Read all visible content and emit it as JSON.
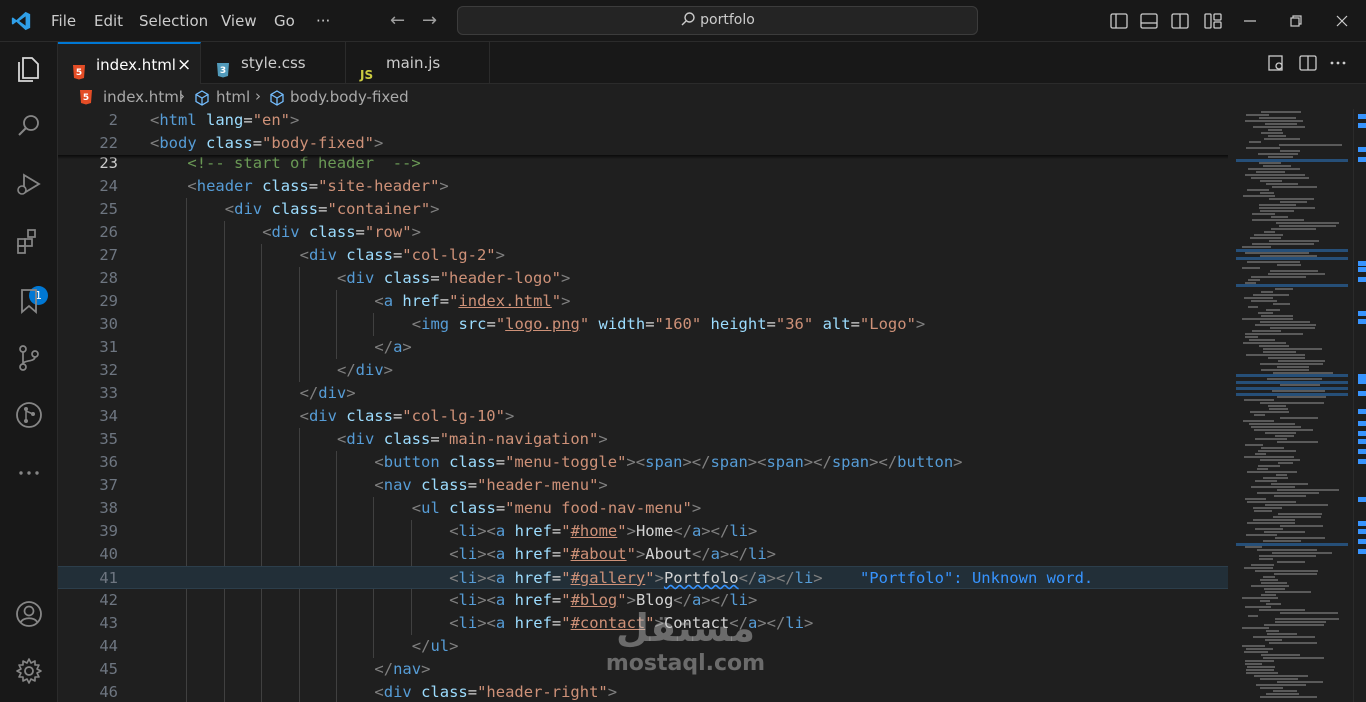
{
  "titlebar": {
    "menu": [
      "File",
      "Edit",
      "Selection",
      "View",
      "Go",
      "···"
    ],
    "search_text": "portfolo",
    "icons": [
      "vscode-logo-icon",
      "back-arrow-icon",
      "forward-arrow-icon",
      "search-icon",
      "toggle-primary-sidebar-icon",
      "toggle-panel-icon",
      "toggle-secondary-sidebar-icon",
      "customize-layout-icon",
      "minimize-icon",
      "restore-icon",
      "close-icon"
    ]
  },
  "activity_bar": {
    "items": [
      "explorer-icon",
      "search-icon",
      "run-debug-icon",
      "extensions-icon",
      "bookmarks-icon",
      "source-control-icon",
      "git-graph-icon",
      "more-icon"
    ],
    "extensions_badge": "1",
    "bottom": [
      "accounts-icon",
      "manage-gear-icon"
    ]
  },
  "tabs": [
    {
      "label": "index.html",
      "icon": "5",
      "icon_color": "#e44d26",
      "active": true,
      "close": "×"
    },
    {
      "label": "style.css",
      "icon": "3",
      "icon_color": "#519aba",
      "active": false
    },
    {
      "label": "main.js",
      "icon": "JS",
      "icon_color": "#cbcb41",
      "active": false
    }
  ],
  "breadcrumb": {
    "file": "index.html",
    "items": [
      "html",
      "body.body-fixed"
    ],
    "sep": "›"
  },
  "editor": {
    "sticky_lines": [
      {
        "n": "2",
        "tokens": [
          [
            "tg",
            "<"
          ],
          [
            "tn",
            "html"
          ],
          [
            "tx",
            " "
          ],
          [
            "an",
            "lang"
          ],
          [
            "tx",
            "="
          ],
          [
            "av",
            "\"en\""
          ],
          [
            "tg",
            ">"
          ]
        ]
      },
      {
        "n": "22",
        "tokens": [
          [
            "tg",
            "<"
          ],
          [
            "tn",
            "body"
          ],
          [
            "tx",
            " "
          ],
          [
            "an",
            "class"
          ],
          [
            "tx",
            "="
          ],
          [
            "av",
            "\"body-fixed\""
          ],
          [
            "tg",
            ">"
          ]
        ]
      }
    ],
    "lines": [
      {
        "n": "23",
        "indent": 1,
        "tokens": [
          [
            "cm",
            "<!-- start of header  -->"
          ]
        ]
      },
      {
        "n": "24",
        "indent": 1,
        "tokens": [
          [
            "tg",
            "<"
          ],
          [
            "tn",
            "header"
          ],
          [
            "tx",
            " "
          ],
          [
            "an",
            "class"
          ],
          [
            "tx",
            "="
          ],
          [
            "av",
            "\"site-header\""
          ],
          [
            "tg",
            ">"
          ]
        ]
      },
      {
        "n": "25",
        "indent": 2,
        "tokens": [
          [
            "tg",
            "<"
          ],
          [
            "tn",
            "div"
          ],
          [
            "tx",
            " "
          ],
          [
            "an",
            "class"
          ],
          [
            "tx",
            "="
          ],
          [
            "av",
            "\"container\""
          ],
          [
            "tg",
            ">"
          ]
        ]
      },
      {
        "n": "26",
        "indent": 3,
        "tokens": [
          [
            "tg",
            "<"
          ],
          [
            "tn",
            "div"
          ],
          [
            "tx",
            " "
          ],
          [
            "an",
            "class"
          ],
          [
            "tx",
            "="
          ],
          [
            "av",
            "\"row\""
          ],
          [
            "tg",
            ">"
          ]
        ]
      },
      {
        "n": "27",
        "indent": 4,
        "tokens": [
          [
            "tg",
            "<"
          ],
          [
            "tn",
            "div"
          ],
          [
            "tx",
            " "
          ],
          [
            "an",
            "class"
          ],
          [
            "tx",
            "="
          ],
          [
            "av",
            "\"col-lg-2\""
          ],
          [
            "tg",
            ">"
          ]
        ]
      },
      {
        "n": "28",
        "indent": 5,
        "tokens": [
          [
            "tg",
            "<"
          ],
          [
            "tn",
            "div"
          ],
          [
            "tx",
            " "
          ],
          [
            "an",
            "class"
          ],
          [
            "tx",
            "="
          ],
          [
            "av",
            "\"header-logo\""
          ],
          [
            "tg",
            ">"
          ]
        ]
      },
      {
        "n": "29",
        "indent": 6,
        "tokens": [
          [
            "tg",
            "<"
          ],
          [
            "tn",
            "a"
          ],
          [
            "tx",
            " "
          ],
          [
            "an",
            "href"
          ],
          [
            "tx",
            "="
          ],
          [
            "av",
            "\""
          ],
          [
            "avu",
            "index.html"
          ],
          [
            "av",
            "\""
          ],
          [
            "tg",
            ">"
          ]
        ]
      },
      {
        "n": "30",
        "indent": 7,
        "tokens": [
          [
            "tg",
            "<"
          ],
          [
            "tn",
            "img"
          ],
          [
            "tx",
            " "
          ],
          [
            "an",
            "src"
          ],
          [
            "tx",
            "="
          ],
          [
            "av",
            "\""
          ],
          [
            "avu",
            "logo.png"
          ],
          [
            "av",
            "\""
          ],
          [
            "tx",
            " "
          ],
          [
            "an",
            "width"
          ],
          [
            "tx",
            "="
          ],
          [
            "av",
            "\"160\""
          ],
          [
            "tx",
            " "
          ],
          [
            "an",
            "height"
          ],
          [
            "tx",
            "="
          ],
          [
            "av",
            "\"36\""
          ],
          [
            "tx",
            " "
          ],
          [
            "an",
            "alt"
          ],
          [
            "tx",
            "="
          ],
          [
            "av",
            "\"Logo\""
          ],
          [
            "tg",
            ">"
          ]
        ]
      },
      {
        "n": "31",
        "indent": 6,
        "tokens": [
          [
            "tg",
            "</"
          ],
          [
            "tn",
            "a"
          ],
          [
            "tg",
            ">"
          ]
        ]
      },
      {
        "n": "32",
        "indent": 5,
        "tokens": [
          [
            "tg",
            "</"
          ],
          [
            "tn",
            "div"
          ],
          [
            "tg",
            ">"
          ]
        ]
      },
      {
        "n": "33",
        "indent": 4,
        "tokens": [
          [
            "tg",
            "</"
          ],
          [
            "tn",
            "div"
          ],
          [
            "tg",
            ">"
          ]
        ]
      },
      {
        "n": "34",
        "indent": 4,
        "tokens": [
          [
            "tg",
            "<"
          ],
          [
            "tn",
            "div"
          ],
          [
            "tx",
            " "
          ],
          [
            "an",
            "class"
          ],
          [
            "tx",
            "="
          ],
          [
            "av",
            "\"col-lg-10\""
          ],
          [
            "tg",
            ">"
          ]
        ]
      },
      {
        "n": "35",
        "indent": 5,
        "tokens": [
          [
            "tg",
            "<"
          ],
          [
            "tn",
            "div"
          ],
          [
            "tx",
            " "
          ],
          [
            "an",
            "class"
          ],
          [
            "tx",
            "="
          ],
          [
            "av",
            "\"main-navigation\""
          ],
          [
            "tg",
            ">"
          ]
        ]
      },
      {
        "n": "36",
        "indent": 6,
        "tokens": [
          [
            "tg",
            "<"
          ],
          [
            "tn",
            "button"
          ],
          [
            "tx",
            " "
          ],
          [
            "an",
            "class"
          ],
          [
            "tx",
            "="
          ],
          [
            "av",
            "\"menu-toggle\""
          ],
          [
            "tg",
            ">"
          ],
          [
            "tg",
            "<"
          ],
          [
            "tn",
            "span"
          ],
          [
            "tg",
            ">"
          ],
          [
            "tg",
            "</"
          ],
          [
            "tn",
            "span"
          ],
          [
            "tg",
            ">"
          ],
          [
            "tg",
            "<"
          ],
          [
            "tn",
            "span"
          ],
          [
            "tg",
            ">"
          ],
          [
            "tg",
            "</"
          ],
          [
            "tn",
            "span"
          ],
          [
            "tg",
            ">"
          ],
          [
            "tg",
            "</"
          ],
          [
            "tn",
            "button"
          ],
          [
            "tg",
            ">"
          ]
        ]
      },
      {
        "n": "37",
        "indent": 6,
        "tokens": [
          [
            "tg",
            "<"
          ],
          [
            "tn",
            "nav"
          ],
          [
            "tx",
            " "
          ],
          [
            "an",
            "class"
          ],
          [
            "tx",
            "="
          ],
          [
            "av",
            "\"header-menu\""
          ],
          [
            "tg",
            ">"
          ]
        ]
      },
      {
        "n": "38",
        "indent": 7,
        "tokens": [
          [
            "tg",
            "<"
          ],
          [
            "tn",
            "ul"
          ],
          [
            "tx",
            " "
          ],
          [
            "an",
            "class"
          ],
          [
            "tx",
            "="
          ],
          [
            "av",
            "\"menu food-nav-menu\""
          ],
          [
            "tg",
            ">"
          ]
        ]
      },
      {
        "n": "39",
        "indent": 8,
        "tokens": [
          [
            "tg",
            "<"
          ],
          [
            "tn",
            "li"
          ],
          [
            "tg",
            ">"
          ],
          [
            "tg",
            "<"
          ],
          [
            "tn",
            "a"
          ],
          [
            "tx",
            " "
          ],
          [
            "an",
            "href"
          ],
          [
            "tx",
            "="
          ],
          [
            "av",
            "\""
          ],
          [
            "avu",
            "#home"
          ],
          [
            "av",
            "\""
          ],
          [
            "tg",
            ">"
          ],
          [
            "tx",
            "Home"
          ],
          [
            "tg",
            "</"
          ],
          [
            "tn",
            "a"
          ],
          [
            "tg",
            ">"
          ],
          [
            "tg",
            "</"
          ],
          [
            "tn",
            "li"
          ],
          [
            "tg",
            ">"
          ]
        ]
      },
      {
        "n": "40",
        "indent": 8,
        "tokens": [
          [
            "tg",
            "<"
          ],
          [
            "tn",
            "li"
          ],
          [
            "tg",
            ">"
          ],
          [
            "tg",
            "<"
          ],
          [
            "tn",
            "a"
          ],
          [
            "tx",
            " "
          ],
          [
            "an",
            "href"
          ],
          [
            "tx",
            "="
          ],
          [
            "av",
            "\""
          ],
          [
            "avu",
            "#about"
          ],
          [
            "av",
            "\""
          ],
          [
            "tg",
            ">"
          ],
          [
            "tx",
            "About"
          ],
          [
            "tg",
            "</"
          ],
          [
            "tn",
            "a"
          ],
          [
            "tg",
            ">"
          ],
          [
            "tg",
            "</"
          ],
          [
            "tn",
            "li"
          ],
          [
            "tg",
            ">"
          ]
        ]
      },
      {
        "n": "41",
        "indent": 8,
        "current": true,
        "tokens": [
          [
            "tg",
            "<"
          ],
          [
            "tn",
            "li"
          ],
          [
            "tg",
            ">"
          ],
          [
            "tg",
            "<"
          ],
          [
            "tn",
            "a"
          ],
          [
            "tx",
            " "
          ],
          [
            "an",
            "href"
          ],
          [
            "tx",
            "="
          ],
          [
            "av",
            "\""
          ],
          [
            "avu",
            "#gallery"
          ],
          [
            "av",
            "\""
          ],
          [
            "tg",
            ">"
          ],
          [
            "sq",
            "Portfolo"
          ],
          [
            "tg",
            "</"
          ],
          [
            "tn",
            "a"
          ],
          [
            "tg",
            ">"
          ],
          [
            "tg",
            "</"
          ],
          [
            "tn",
            "li"
          ],
          [
            "tg",
            ">"
          ],
          [
            "tx",
            "    "
          ],
          [
            "diag",
            "\"Portfolo\": Unknown word."
          ]
        ]
      },
      {
        "n": "42",
        "indent": 8,
        "tokens": [
          [
            "tg",
            "<"
          ],
          [
            "tn",
            "li"
          ],
          [
            "tg",
            ">"
          ],
          [
            "tg",
            "<"
          ],
          [
            "tn",
            "a"
          ],
          [
            "tx",
            " "
          ],
          [
            "an",
            "href"
          ],
          [
            "tx",
            "="
          ],
          [
            "av",
            "\""
          ],
          [
            "avu",
            "#blog"
          ],
          [
            "av",
            "\""
          ],
          [
            "tg",
            ">"
          ],
          [
            "tx",
            "Blog"
          ],
          [
            "tg",
            "</"
          ],
          [
            "tn",
            "a"
          ],
          [
            "tg",
            ">"
          ],
          [
            "tg",
            "</"
          ],
          [
            "tn",
            "li"
          ],
          [
            "tg",
            ">"
          ]
        ]
      },
      {
        "n": "43",
        "indent": 8,
        "tokens": [
          [
            "tg",
            "<"
          ],
          [
            "tn",
            "li"
          ],
          [
            "tg",
            ">"
          ],
          [
            "tg",
            "<"
          ],
          [
            "tn",
            "a"
          ],
          [
            "tx",
            " "
          ],
          [
            "an",
            "href"
          ],
          [
            "tx",
            "="
          ],
          [
            "av",
            "\""
          ],
          [
            "avu",
            "#contact"
          ],
          [
            "av",
            "\""
          ],
          [
            "tg",
            ">"
          ],
          [
            "tx",
            "Contact"
          ],
          [
            "tg",
            "</"
          ],
          [
            "tn",
            "a"
          ],
          [
            "tg",
            ">"
          ],
          [
            "tg",
            "</"
          ],
          [
            "tn",
            "li"
          ],
          [
            "tg",
            ">"
          ]
        ]
      },
      {
        "n": "44",
        "indent": 7,
        "tokens": [
          [
            "tg",
            "</"
          ],
          [
            "tn",
            "ul"
          ],
          [
            "tg",
            ">"
          ]
        ]
      },
      {
        "n": "45",
        "indent": 6,
        "tokens": [
          [
            "tg",
            "</"
          ],
          [
            "tn",
            "nav"
          ],
          [
            "tg",
            ">"
          ]
        ]
      },
      {
        "n": "46",
        "indent": 6,
        "tokens": [
          [
            "tg",
            "<"
          ],
          [
            "tn",
            "div"
          ],
          [
            "tx",
            " "
          ],
          [
            "an",
            "class"
          ],
          [
            "tx",
            "="
          ],
          [
            "av",
            "\"header-right\""
          ],
          [
            "tg",
            ">"
          ]
        ]
      }
    ]
  },
  "watermark": {
    "arabic": "مستقل",
    "latin": "mostaql.com"
  }
}
